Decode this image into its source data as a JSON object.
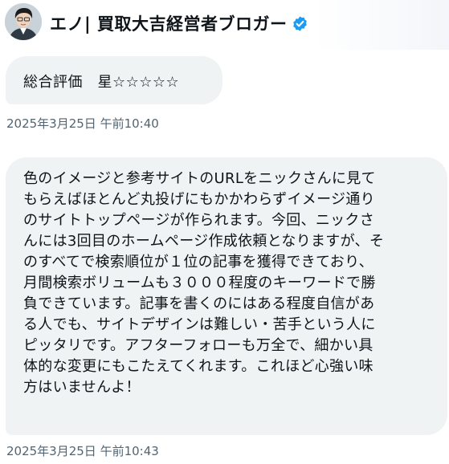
{
  "header": {
    "display_name": "エノ| 買取大吉経営者ブロガー",
    "avatar_icon": "person-avatar-icon",
    "verified_icon": "verified-badge-icon",
    "accent": "#1d9bf0"
  },
  "messages": [
    {
      "text": "総合評価　星☆☆☆☆☆",
      "timestamp": "2025年3月25日 午前10:40"
    },
    {
      "lines": [
        "色のイメージと参考サイトのURLをニックさんに見て",
        "もらえばほとんど丸投げにもかかわらずイメージ通り",
        "のサイトトップページが作られます。今回、ニックさ",
        "んには3回目のホームページ作成依頼となりますが、そ",
        "のすべてで検索順位が１位の記事を獲得できており、",
        "月間検索ボリュームも３０００程度のキーワードで勝",
        "負できています。記事を書くのにはある程度自信があ",
        "る人でも、サイトデザインは難しい・苦手という人に",
        "ピッタリです。アフターフォローも万全で、細かい具",
        "体的な変更にもこたえてくれます。これほど心強い味",
        "方はいませんよ！"
      ],
      "timestamp": "2025年3月25日 午前10:43"
    }
  ]
}
